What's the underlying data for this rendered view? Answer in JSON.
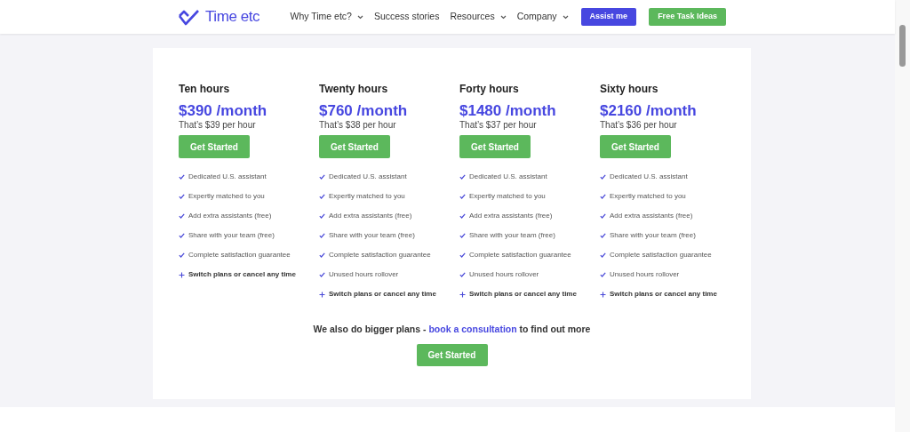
{
  "header": {
    "logo": "Time etc",
    "nav": [
      {
        "label": "Why Time etc?",
        "dropdown": true
      },
      {
        "label": "Success stories",
        "dropdown": false
      },
      {
        "label": "Resources",
        "dropdown": true
      },
      {
        "label": "Company",
        "dropdown": true
      }
    ],
    "buttons": [
      {
        "label": "Assist me",
        "kind": "primary"
      },
      {
        "label": "Free Task Ideas",
        "kind": "success"
      }
    ]
  },
  "plans": [
    {
      "name": "Ten hours",
      "price": "$390 /month",
      "rate": "That’s $39 per hour",
      "button": "Get Started",
      "features": [
        {
          "kind": "check",
          "text": "Dedicated U.S. assistant"
        },
        {
          "kind": "check",
          "text": "Expertly matched to you"
        },
        {
          "kind": "check",
          "text": "Add extra assistants (free)"
        },
        {
          "kind": "check",
          "text": "Share with your team (free)"
        },
        {
          "kind": "check",
          "text": "Complete satisfaction guarantee"
        },
        {
          "kind": "plus",
          "text": "Switch plans or cancel any time"
        }
      ]
    },
    {
      "name": "Twenty hours",
      "price": "$760 /month",
      "rate": "That’s $38 per hour",
      "button": "Get Started",
      "features": [
        {
          "kind": "check",
          "text": "Dedicated U.S. assistant"
        },
        {
          "kind": "check",
          "text": "Expertly matched to you"
        },
        {
          "kind": "check",
          "text": "Add extra assistants (free)"
        },
        {
          "kind": "check",
          "text": "Share with your team (free)"
        },
        {
          "kind": "check",
          "text": "Complete satisfaction guarantee"
        },
        {
          "kind": "check",
          "text": "Unused hours rollover"
        },
        {
          "kind": "plus",
          "text": "Switch plans or cancel any time"
        }
      ]
    },
    {
      "name": "Forty hours",
      "price": "$1480 /month",
      "rate": "That’s $37 per hour",
      "button": "Get Started",
      "features": [
        {
          "kind": "check",
          "text": "Dedicated U.S. assistant"
        },
        {
          "kind": "check",
          "text": "Expertly matched to you"
        },
        {
          "kind": "check",
          "text": "Add extra assistants (free)"
        },
        {
          "kind": "check",
          "text": "Share with your team (free)"
        },
        {
          "kind": "check",
          "text": "Complete satisfaction guarantee"
        },
        {
          "kind": "check",
          "text": "Unused hours rollover"
        },
        {
          "kind": "plus",
          "text": "Switch plans or cancel any time"
        }
      ]
    },
    {
      "name": "Sixty hours",
      "price": "$2160 /month",
      "rate": "That’s $36 per hour",
      "button": "Get Started",
      "features": [
        {
          "kind": "check",
          "text": "Dedicated U.S. assistant"
        },
        {
          "kind": "check",
          "text": "Expertly matched to you"
        },
        {
          "kind": "check",
          "text": "Add extra assistants (free)"
        },
        {
          "kind": "check",
          "text": "Share with your team (free)"
        },
        {
          "kind": "check",
          "text": "Complete satisfaction guarantee"
        },
        {
          "kind": "check",
          "text": "Unused hours rollover"
        },
        {
          "kind": "plus",
          "text": "Switch plans or cancel any time"
        }
      ]
    }
  ],
  "footer_note": {
    "before": "We also do bigger plans - ",
    "link": "book a consultation",
    "after": " to find out more",
    "button": "Get Started"
  }
}
